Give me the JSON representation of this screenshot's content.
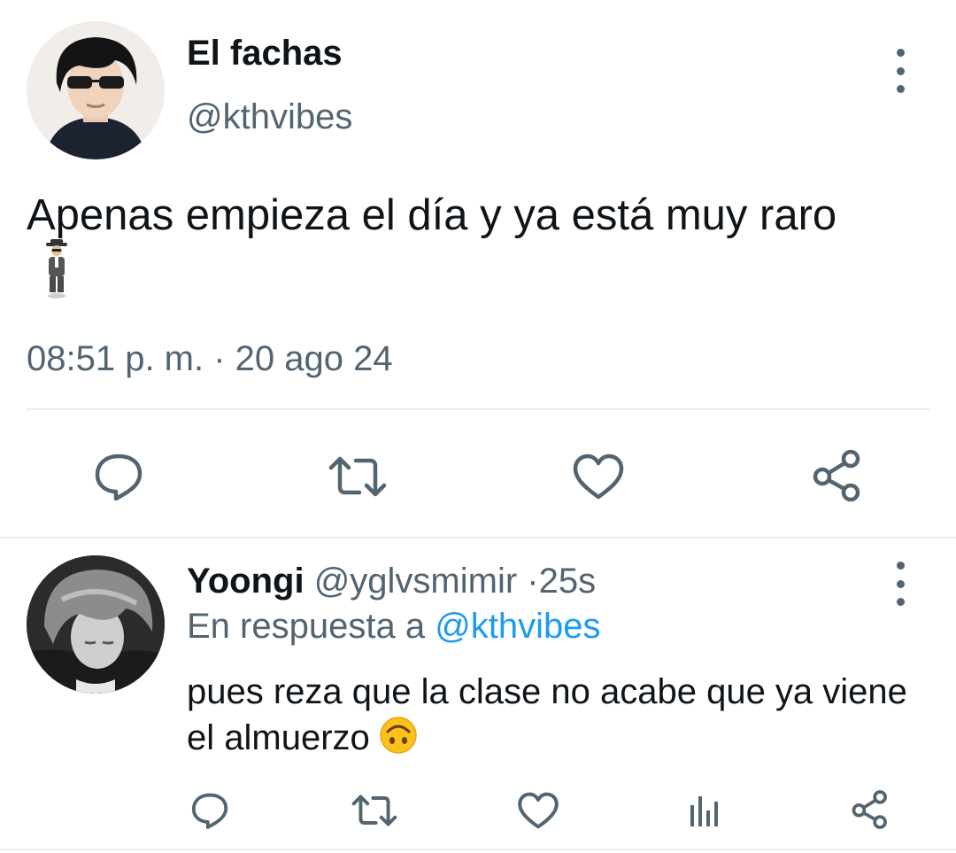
{
  "main_tweet": {
    "author_name": "El fachas",
    "author_handle": "@kthvibes",
    "text": "Apenas empieza el día y ya está muy raro",
    "emoji_name": "levitating-man-emoji",
    "timestamp": "08:51 p. m. · 20 ago 24",
    "actions": [
      "reply-icon",
      "retweet-icon",
      "like-icon",
      "share-icon"
    ]
  },
  "reply_tweet": {
    "author_name": "Yoongi",
    "author_handle": "@yglvsmimir",
    "separator": "·",
    "time": "25s",
    "reply_prefix": "En respuesta a",
    "reply_to_handle": "@kthvibes",
    "text": "pues reza que la clase no acabe que ya viene el almuerzo",
    "emoji_name": "upside-down-face-emoji",
    "actions": [
      "reply-icon",
      "retweet-icon",
      "like-icon",
      "analytics-icon",
      "share-icon"
    ]
  },
  "colors": {
    "text_primary": "#0f1419",
    "text_secondary": "#536471",
    "link": "#1d9bf0",
    "divider": "#e6ecf0"
  }
}
